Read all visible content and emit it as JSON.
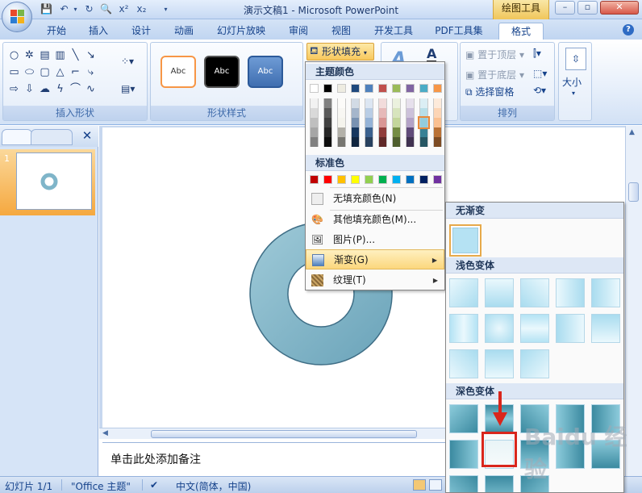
{
  "window": {
    "title": "演示文稿1 - Microsoft PowerPoint",
    "contextual_tab": "绘图工具",
    "minimize": "–",
    "maximize": "▫",
    "close": "✕"
  },
  "ribbon_tabs": [
    "开始",
    "插入",
    "设计",
    "动画",
    "幻灯片放映",
    "审阅",
    "视图",
    "开发工具",
    "PDF工具集",
    "格式"
  ],
  "active_tab": "格式",
  "groups": {
    "insert_shapes": "插入形状",
    "shape_styles": "形状样式",
    "arrange": "排列",
    "size": "大小"
  },
  "shape_styles": [
    "Abc",
    "Abc",
    "Abc"
  ],
  "fill_button": "形状填充",
  "arrange_items": {
    "bring_front": "置于顶层",
    "send_back": "置于底层",
    "selection_pane": "选择窗格"
  },
  "fill_menu": {
    "theme_colors_header": "主题颜色",
    "standard_colors_header": "标准色",
    "theme_colors": [
      "#ffffff",
      "#000000",
      "#eeece1",
      "#1f497d",
      "#4f81bd",
      "#c0504d",
      "#9bbb59",
      "#8064a2",
      "#4bacc6",
      "#f79646"
    ],
    "standard_colors": [
      "#c00000",
      "#ff0000",
      "#ffc000",
      "#ffff00",
      "#92d050",
      "#00b050",
      "#00b0f0",
      "#0070c0",
      "#002060",
      "#7030a0"
    ],
    "no_fill": "无填充颜色(N)",
    "more_colors": "其他填充颜色(M)...",
    "picture": "图片(P)...",
    "gradient": "渐变(G)",
    "texture": "纹理(T)"
  },
  "gradient_menu": {
    "no_gradient": "无渐变",
    "light_variations": "浅色变体",
    "dark_variations": "深色变体"
  },
  "slide_panel": {
    "thumbnail_number": "1"
  },
  "notes_placeholder": "单击此处添加备注",
  "status_bar": {
    "slide_info": "幻灯片 1/1",
    "theme": "\"Office 主题\"",
    "language": "中文(简体，中国)"
  },
  "watermark": "Baidu 经验",
  "colors": {
    "donut_fill": "#7fb5c9",
    "accent_orange": "#f5a83f",
    "highlight_red": "#d9261c"
  }
}
